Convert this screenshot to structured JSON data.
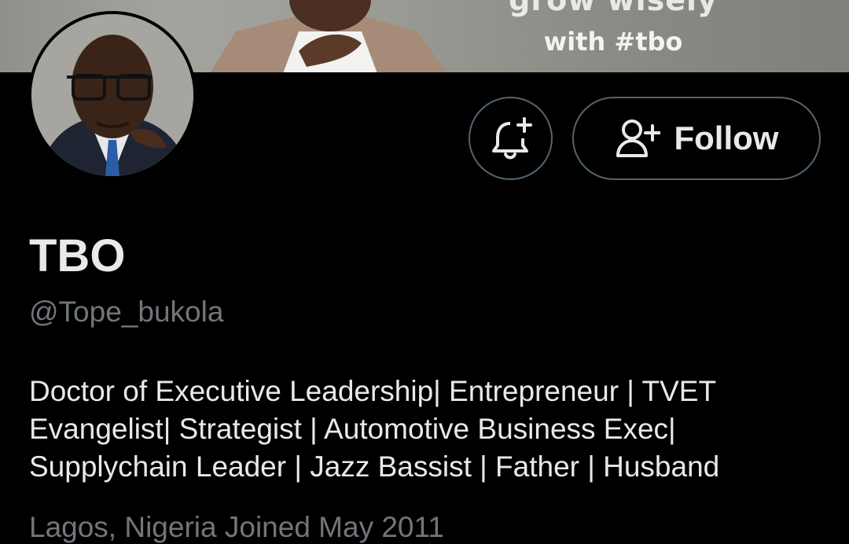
{
  "banner": {
    "line1": "grow wisely",
    "line2": "with #tbo"
  },
  "profile": {
    "display_name": "TBO",
    "handle": "@Tope_bukola",
    "bio": "Doctor of Executive Leadership| Entrepreneur | TVET Evangelist| Strategist | Automotive Business Exec| Supplychain Leader | Jazz Bassist | Father | Husband",
    "meta": "Lagos, Nigeria   Joined May 2011"
  },
  "actions": {
    "notify_icon": "bell-plus-icon",
    "follow_icon": "person-plus-icon",
    "follow_label": "Follow"
  },
  "colors": {
    "background": "#000000",
    "text_primary": "#e7e9ea",
    "text_secondary": "#71767b",
    "button_border": "#536471"
  }
}
